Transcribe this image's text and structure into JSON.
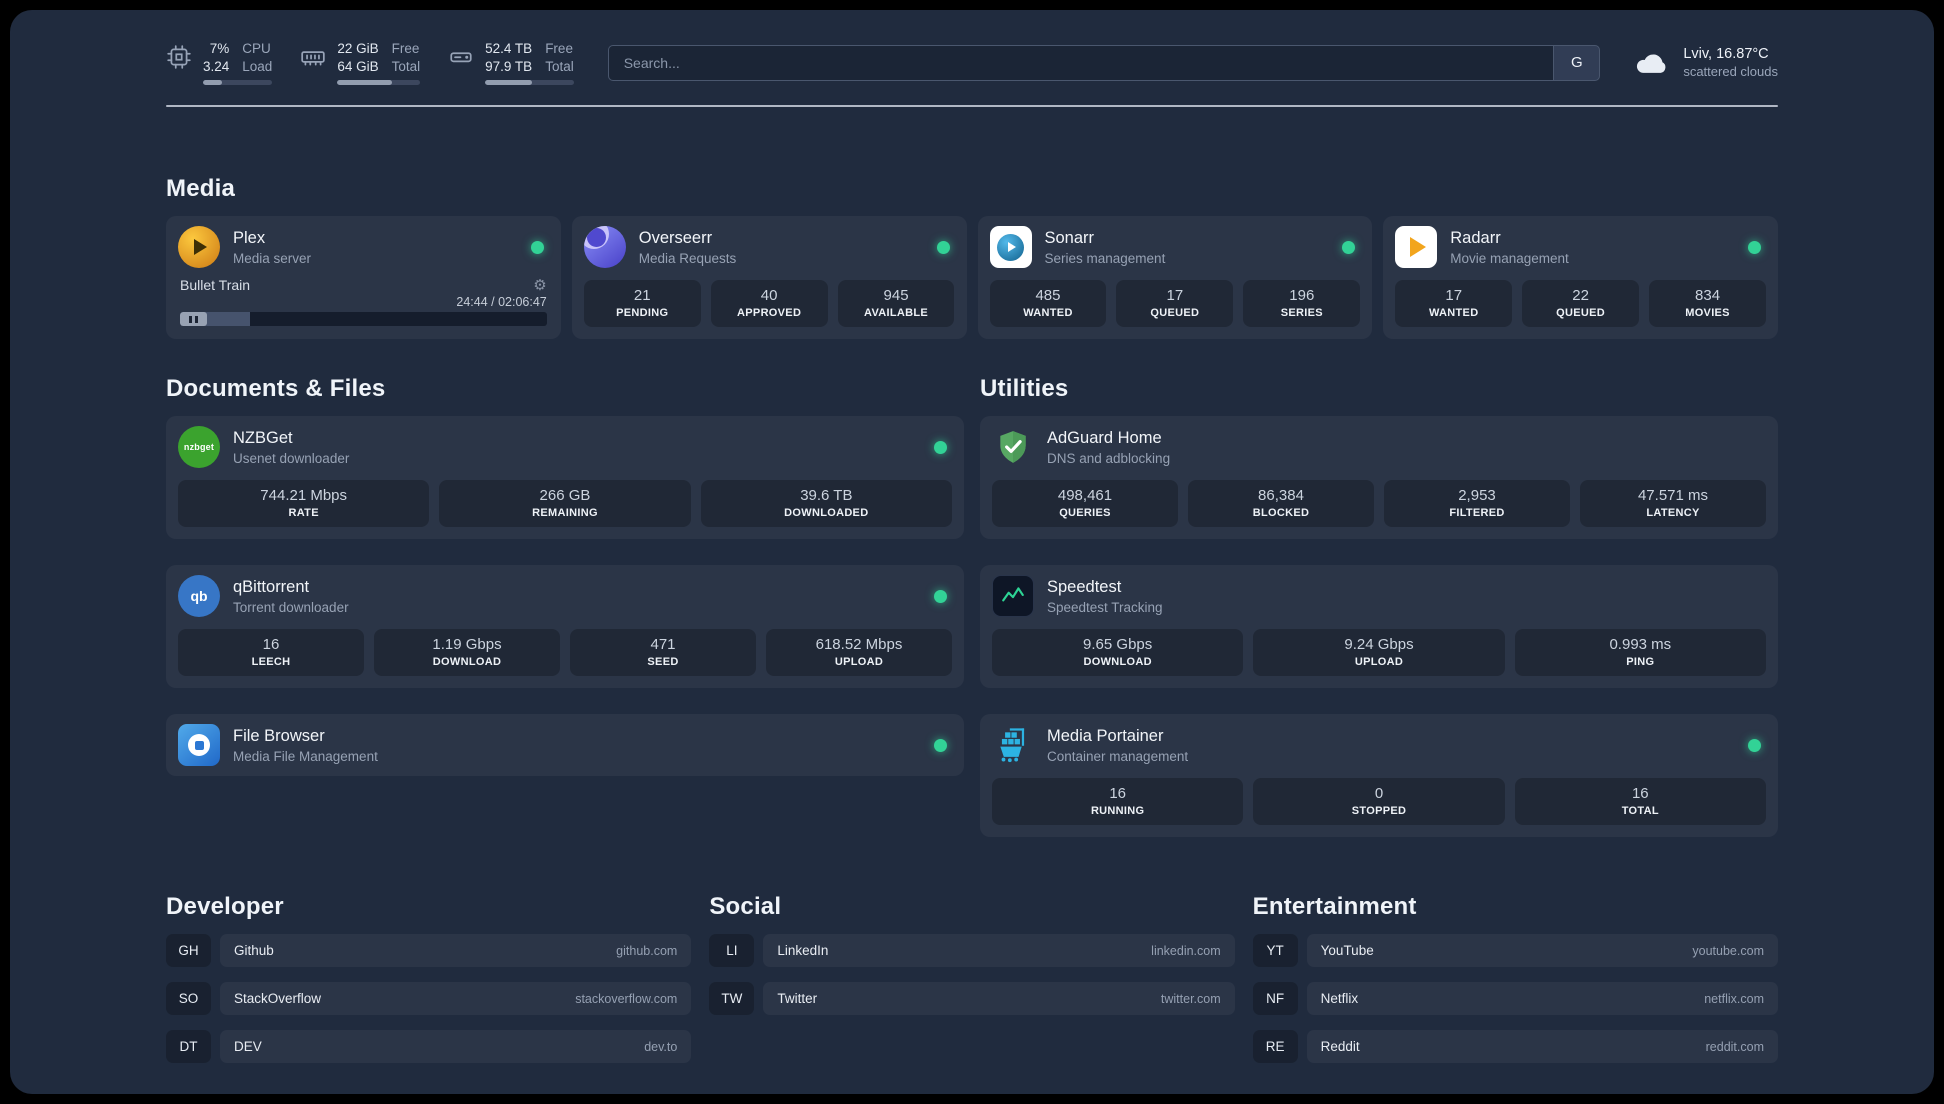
{
  "colors": {
    "status_online": "#32d296",
    "accent_green": "#2dd495"
  },
  "header": {
    "resources": [
      {
        "name": "cpu",
        "rows": [
          {
            "value": "7%",
            "label": "CPU"
          },
          {
            "value": "3.24",
            "label": "Load"
          }
        ],
        "progress": 28
      },
      {
        "name": "memory",
        "rows": [
          {
            "value": "22 GiB",
            "label": "Free"
          },
          {
            "value": "64 GiB",
            "label": "Total"
          }
        ],
        "progress": 66
      },
      {
        "name": "disk",
        "rows": [
          {
            "value": "52.4 TB",
            "label": "Free"
          },
          {
            "value": "97.9 TB",
            "label": "Total"
          }
        ],
        "progress": 53
      }
    ],
    "search": {
      "placeholder": "Search...",
      "button": "G"
    },
    "weather": {
      "location": "Lviv, 16.87°C",
      "condition": "scattered clouds"
    }
  },
  "media": {
    "title": "Media",
    "plex": {
      "name": "Plex",
      "desc": "Media server",
      "now_playing": "Bullet Train",
      "time": "24:44 / 02:06:47",
      "progress_pct": 19
    },
    "overseerr": {
      "name": "Overseerr",
      "desc": "Media Requests",
      "stats": [
        {
          "value": "21",
          "label": "PENDING"
        },
        {
          "value": "40",
          "label": "APPROVED"
        },
        {
          "value": "945",
          "label": "AVAILABLE"
        }
      ]
    },
    "sonarr": {
      "name": "Sonarr",
      "desc": "Series management",
      "stats": [
        {
          "value": "485",
          "label": "WANTED"
        },
        {
          "value": "17",
          "label": "QUEUED"
        },
        {
          "value": "196",
          "label": "SERIES"
        }
      ]
    },
    "radarr": {
      "name": "Radarr",
      "desc": "Movie management",
      "stats": [
        {
          "value": "17",
          "label": "WANTED"
        },
        {
          "value": "22",
          "label": "QUEUED"
        },
        {
          "value": "834",
          "label": "MOVIES"
        }
      ]
    }
  },
  "documents": {
    "title": "Documents & Files",
    "nzbget": {
      "name": "NZBGet",
      "desc": "Usenet downloader",
      "icon_text": "nzbget",
      "stats": [
        {
          "value": "744.21 Mbps",
          "label": "RATE"
        },
        {
          "value": "266 GB",
          "label": "REMAINING"
        },
        {
          "value": "39.6 TB",
          "label": "DOWNLOADED"
        }
      ]
    },
    "qbittorrent": {
      "name": "qBittorrent",
      "desc": "Torrent downloader",
      "icon_text": "qb",
      "stats": [
        {
          "value": "16",
          "label": "LEECH"
        },
        {
          "value": "1.19 Gbps",
          "label": "DOWNLOAD"
        },
        {
          "value": "471",
          "label": "SEED"
        },
        {
          "value": "618.52 Mbps",
          "label": "UPLOAD"
        }
      ]
    },
    "filebrowser": {
      "name": "File Browser",
      "desc": "Media File Management"
    }
  },
  "utilities": {
    "title": "Utilities",
    "adguard": {
      "name": "AdGuard Home",
      "desc": "DNS and adblocking",
      "stats": [
        {
          "value": "498,461",
          "label": "QUERIES"
        },
        {
          "value": "86,384",
          "label": "BLOCKED"
        },
        {
          "value": "2,953",
          "label": "FILTERED"
        },
        {
          "value": "47.571 ms",
          "label": "LATENCY"
        }
      ]
    },
    "speedtest": {
      "name": "Speedtest",
      "desc": "Speedtest Tracking",
      "stats": [
        {
          "value": "9.65 Gbps",
          "label": "DOWNLOAD"
        },
        {
          "value": "9.24 Gbps",
          "label": "UPLOAD"
        },
        {
          "value": "0.993 ms",
          "label": "PING"
        }
      ]
    },
    "portainer": {
      "name": "Media Portainer",
      "desc": "Container management",
      "stats": [
        {
          "value": "16",
          "label": "RUNNING"
        },
        {
          "value": "0",
          "label": "STOPPED"
        },
        {
          "value": "16",
          "label": "TOTAL"
        }
      ]
    }
  },
  "bookmarks": {
    "developer": {
      "title": "Developer",
      "items": [
        {
          "abbr": "GH",
          "name": "Github",
          "url": "github.com"
        },
        {
          "abbr": "SO",
          "name": "StackOverflow",
          "url": "stackoverflow.com"
        },
        {
          "abbr": "DT",
          "name": "DEV",
          "url": "dev.to"
        }
      ]
    },
    "social": {
      "title": "Social",
      "items": [
        {
          "abbr": "LI",
          "name": "LinkedIn",
          "url": "linkedin.com"
        },
        {
          "abbr": "TW",
          "name": "Twitter",
          "url": "twitter.com"
        }
      ]
    },
    "entertainment": {
      "title": "Entertainment",
      "items": [
        {
          "abbr": "YT",
          "name": "YouTube",
          "url": "youtube.com"
        },
        {
          "abbr": "NF",
          "name": "Netflix",
          "url": "netflix.com"
        },
        {
          "abbr": "RE",
          "name": "Reddit",
          "url": "reddit.com"
        }
      ]
    }
  }
}
